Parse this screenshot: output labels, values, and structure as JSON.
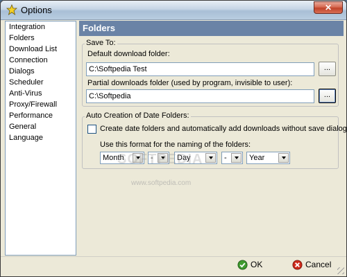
{
  "window": {
    "title": "Options",
    "close_label": "✕"
  },
  "sidebar": {
    "items": [
      {
        "label": "Integration"
      },
      {
        "label": "Folders"
      },
      {
        "label": "Download List"
      },
      {
        "label": "Connection"
      },
      {
        "label": "Dialogs"
      },
      {
        "label": "Scheduler"
      },
      {
        "label": "Anti-Virus"
      },
      {
        "label": "Proxy/Firewall"
      },
      {
        "label": "Performance"
      },
      {
        "label": "General"
      },
      {
        "label": "Language"
      }
    ]
  },
  "panel": {
    "header": "Folders",
    "save_to": {
      "legend": "Save To:",
      "default_label": "Default download folder:",
      "default_value": "C:\\Softpedia Test",
      "partial_label": "Partial downloads folder (used by program, invisible to user):",
      "partial_value": "C:\\Softpedia",
      "browse_label": "..."
    },
    "date_folders": {
      "legend": "Auto Creation of Date Folders:",
      "checkbox_label": "Create date folders and automatically add downloads without save dialog",
      "checked": false,
      "format_label": "Use this format for the naming of the folders:",
      "selects": [
        "Month",
        "-",
        "Day",
        "-",
        "Year"
      ]
    }
  },
  "watermark": {
    "text": "SOFTPEDIA",
    "url": "www.softpedia.com"
  },
  "buttons": {
    "ok": "OK",
    "cancel": "Cancel"
  }
}
